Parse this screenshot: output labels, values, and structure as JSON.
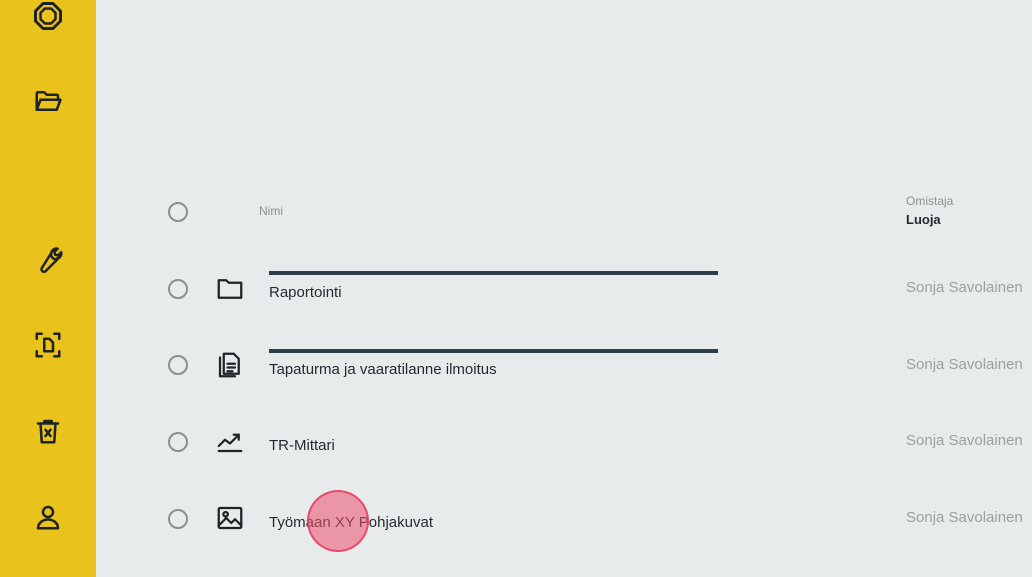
{
  "sidebar": {
    "items": [
      {
        "icon": "octagon-logo-icon"
      },
      {
        "icon": "folder-open-icon"
      },
      {
        "icon": "wrench-icon"
      },
      {
        "icon": "document-scan-icon"
      },
      {
        "icon": "trash-icon"
      },
      {
        "icon": "user-icon"
      }
    ],
    "bg_color": "#e9c21c"
  },
  "table": {
    "header": {
      "name_label": "Nimi",
      "owner_label": "Omistaja",
      "owner_sublabel": "Luoja"
    },
    "rows": [
      {
        "name": "Raportointi",
        "owner": "Sonja Savolainen",
        "icon": "folder-icon",
        "progress": 1.0
      },
      {
        "name": "Tapaturma ja vaaratilanne ilmoitus",
        "owner": "Sonja Savolainen",
        "icon": "documents-icon",
        "progress": 1.0
      },
      {
        "name": "TR-Mittari",
        "owner": "Sonja Savolainen",
        "icon": "chart-line-icon"
      },
      {
        "name": "Työmaan XY Pohjakuvat",
        "owner": "Sonja Savolainen",
        "icon": "image-icon"
      }
    ]
  },
  "colors": {
    "background": "#e8ebec",
    "progress_bar": "#2b3f49",
    "owner_text": "#9ca0a3"
  }
}
